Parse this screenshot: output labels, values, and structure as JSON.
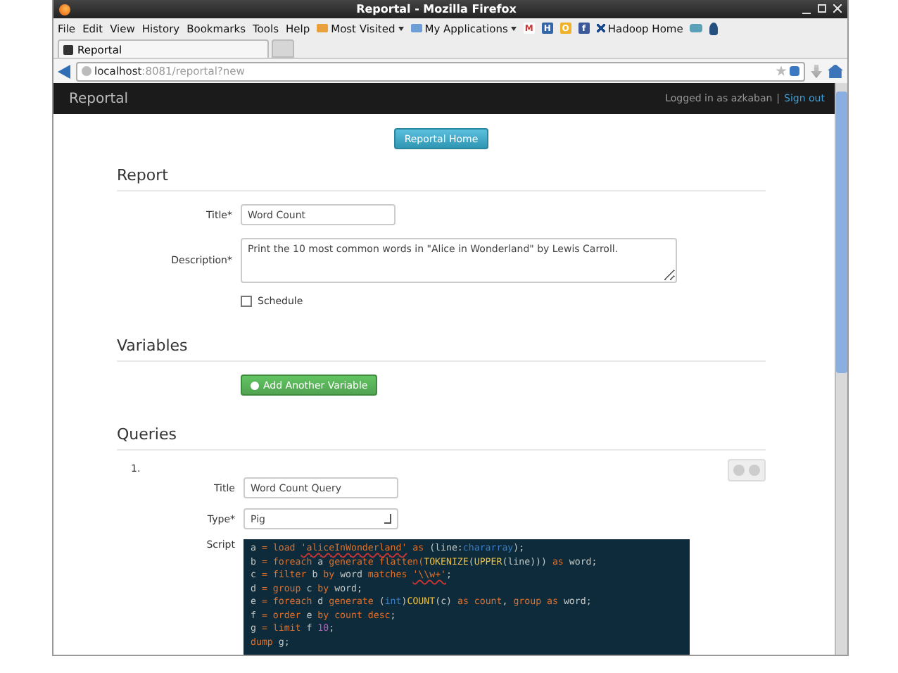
{
  "window": {
    "title": "Reportal - Mozilla Firefox"
  },
  "menu": [
    "File",
    "Edit",
    "View",
    "History",
    "Bookmarks",
    "Tools",
    "Help"
  ],
  "bookmarks": [
    {
      "kind": "folder",
      "label": "Most Visited"
    },
    {
      "kind": "folder",
      "label": "My Applications"
    },
    {
      "kind": "icon",
      "label": "M"
    },
    {
      "kind": "icon",
      "label": "H"
    },
    {
      "kind": "icon",
      "label": "O"
    },
    {
      "kind": "icon",
      "label": "f"
    },
    {
      "kind": "link",
      "label": "Hadoop Home"
    }
  ],
  "tabs": [
    {
      "label": "Reportal",
      "selected": true
    }
  ],
  "address": {
    "host": "localhost",
    "rest": ":8081/reportal?new"
  },
  "navbar": {
    "brand": "Reportal",
    "user": "Logged in as azkaban",
    "separator": "|",
    "signout": "Sign out"
  },
  "home_button": "Reportal Home",
  "report": {
    "heading": "Report",
    "title_label": "Title*",
    "title_value": "Word Count",
    "description_label": "Description*",
    "description_value": "Print the 10 most common words in \"Alice in Wonderland\" by Lewis Carroll.",
    "schedule": {
      "label": "Schedule",
      "checked": false
    }
  },
  "variables": {
    "heading": "Variables",
    "add_button": "Add Another Variable"
  },
  "queries": {
    "heading": "Queries",
    "items": [
      {
        "number": "1.",
        "title_label": "Title",
        "title_value": "Word Count Query",
        "type_label": "Type*",
        "type_value": "Pig",
        "script_label": "Script",
        "script": [
          [
            {
              "kind": "plain",
              "text": "a "
            },
            {
              "kind": "kw",
              "text": "= load "
            },
            {
              "kind": "str",
              "text": "'aliceInWonderland'"
            },
            {
              "kind": "kw",
              "text": " as "
            },
            {
              "kind": "plain",
              "text": "(line:"
            },
            {
              "kind": "type",
              "text": "chararray"
            },
            {
              "kind": "plain",
              "text": ");"
            }
          ],
          [
            {
              "kind": "plain",
              "text": "b "
            },
            {
              "kind": "kw",
              "text": "= foreach "
            },
            {
              "kind": "plain",
              "text": "a "
            },
            {
              "kind": "kw",
              "text": "generate "
            },
            {
              "kind": "kw",
              "text": "flatten("
            },
            {
              "kind": "fn",
              "text": "TOKENIZE"
            },
            {
              "kind": "plain",
              "text": "("
            },
            {
              "kind": "fn",
              "text": "UPPER"
            },
            {
              "kind": "plain",
              "text": "(line))) "
            },
            {
              "kind": "kw",
              "text": "as "
            },
            {
              "kind": "plain",
              "text": "word;"
            }
          ],
          [
            {
              "kind": "plain",
              "text": "c "
            },
            {
              "kind": "kw",
              "text": "= filter "
            },
            {
              "kind": "plain",
              "text": "b "
            },
            {
              "kind": "kw",
              "text": "by "
            },
            {
              "kind": "plain",
              "text": "word "
            },
            {
              "kind": "kw",
              "text": "matches "
            },
            {
              "kind": "str",
              "text": "'\\\\w+'"
            },
            {
              "kind": "plain",
              "text": ";"
            }
          ],
          [
            {
              "kind": "plain",
              "text": "d "
            },
            {
              "kind": "kw",
              "text": "= group "
            },
            {
              "kind": "plain",
              "text": "c "
            },
            {
              "kind": "kw",
              "text": "by "
            },
            {
              "kind": "plain",
              "text": "word;"
            }
          ],
          [
            {
              "kind": "plain",
              "text": "e "
            },
            {
              "kind": "kw",
              "text": "= foreach "
            },
            {
              "kind": "plain",
              "text": "d "
            },
            {
              "kind": "kw",
              "text": "generate "
            },
            {
              "kind": "plain",
              "text": "("
            },
            {
              "kind": "type",
              "text": "int"
            },
            {
              "kind": "plain",
              "text": ")"
            },
            {
              "kind": "fn",
              "text": "COUNT"
            },
            {
              "kind": "plain",
              "text": "(c) "
            },
            {
              "kind": "kw",
              "text": "as count"
            },
            {
              "kind": "plain",
              "text": ", "
            },
            {
              "kind": "kw",
              "text": "group as "
            },
            {
              "kind": "plain",
              "text": "word;"
            }
          ],
          [
            {
              "kind": "plain",
              "text": "f "
            },
            {
              "kind": "kw",
              "text": "= order "
            },
            {
              "kind": "plain",
              "text": "e "
            },
            {
              "kind": "kw",
              "text": "by count desc"
            },
            {
              "kind": "plain",
              "text": ";"
            }
          ],
          [
            {
              "kind": "plain",
              "text": "g "
            },
            {
              "kind": "kw",
              "text": "= limit "
            },
            {
              "kind": "plain",
              "text": "f "
            },
            {
              "kind": "num",
              "text": "10"
            },
            {
              "kind": "plain",
              "text": ";"
            }
          ],
          [
            {
              "kind": "kw",
              "text": "dump "
            },
            {
              "kind": "plain",
              "text": "g;"
            }
          ]
        ]
      }
    ]
  }
}
